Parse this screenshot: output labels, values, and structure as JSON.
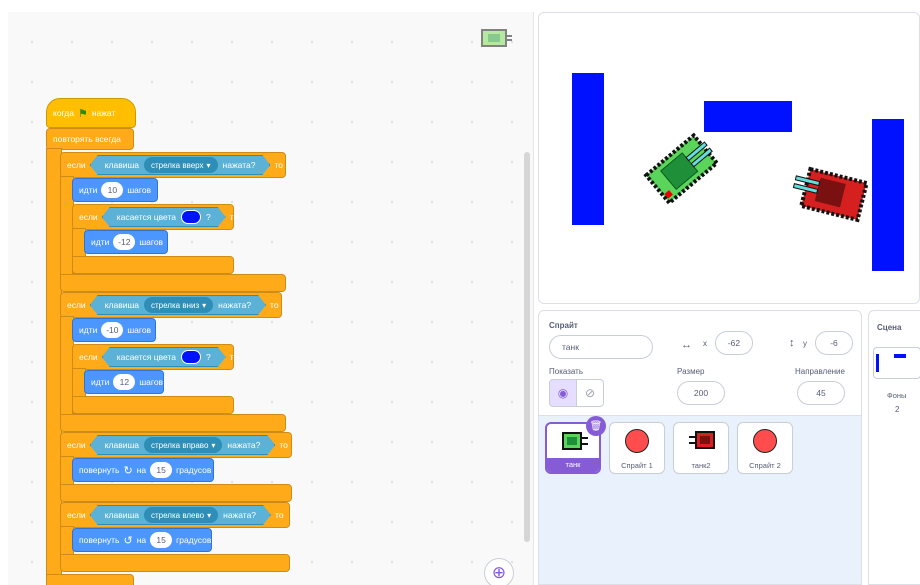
{
  "code": {
    "when_flag": [
      "когда",
      "нажат"
    ],
    "forever": "повторять всегда",
    "if_blocks": [
      {
        "if": "если",
        "key": "клавиша",
        "key_name": "стрелка вверх",
        "pressed": "нажата?",
        "then": "то",
        "move": {
          "word": "идти",
          "value": "10",
          "unit": "шагов"
        },
        "touch": {
          "if": "если",
          "label": "касается цвета",
          "q": "?",
          "then": "то",
          "color": "#0011ff"
        },
        "back": {
          "word": "идти",
          "value": "-12",
          "unit": "шагов"
        }
      },
      {
        "if": "если",
        "key": "клавиша",
        "key_name": "стрелка вниз",
        "pressed": "нажата?",
        "then": "то",
        "move": {
          "word": "идти",
          "value": "-10",
          "unit": "шагов"
        },
        "touch": {
          "if": "если",
          "label": "касается цвета",
          "q": "?",
          "then": "то",
          "color": "#0011ff"
        },
        "back": {
          "word": "идти",
          "value": "12",
          "unit": "шагов"
        }
      },
      {
        "if": "если",
        "key": "клавиша",
        "key_name": "стрелка вправо",
        "pressed": "нажата?",
        "then": "то",
        "turn": {
          "word": "повернуть",
          "on": "на",
          "value": "15",
          "unit": "градусов"
        }
      },
      {
        "if": "если",
        "key": "клавиша",
        "key_name": "стрелка влево",
        "pressed": "нажата?",
        "then": "то",
        "turn": {
          "word": "повернуть",
          "on": "на",
          "value": "15",
          "unit": "градусов"
        }
      }
    ]
  },
  "sprite_panel": {
    "sprite_label": "Спрайт",
    "sprite_name": "танк",
    "x_label": "x",
    "x_value": "-62",
    "y_label": "y",
    "y_value": "-6",
    "show_label": "Показать",
    "size_label": "Размер",
    "size_value": "200",
    "direction_label": "Направление",
    "direction_value": "45"
  },
  "sprites": [
    "танк",
    "Спрайт 1",
    "танк2",
    "Спрайт 2"
  ],
  "scene": {
    "title": "Сцена",
    "backdrops_label": "Фоны",
    "backdrops_count": "2"
  },
  "colors": {
    "wall": "#0011ff",
    "accent": "#855cd6",
    "events": "#ffbf00",
    "control": "#ffab19",
    "motion": "#4c97ff",
    "sensing": "#5cb1d6"
  },
  "icons": [
    "green-flag-icon",
    "dropdown-arrow-icon",
    "turn-right-icon",
    "turn-left-icon",
    "zoom-in-icon",
    "eye-icon",
    "eye-off-icon",
    "trash-icon",
    "x-arrows-icon",
    "y-arrows-icon"
  ]
}
